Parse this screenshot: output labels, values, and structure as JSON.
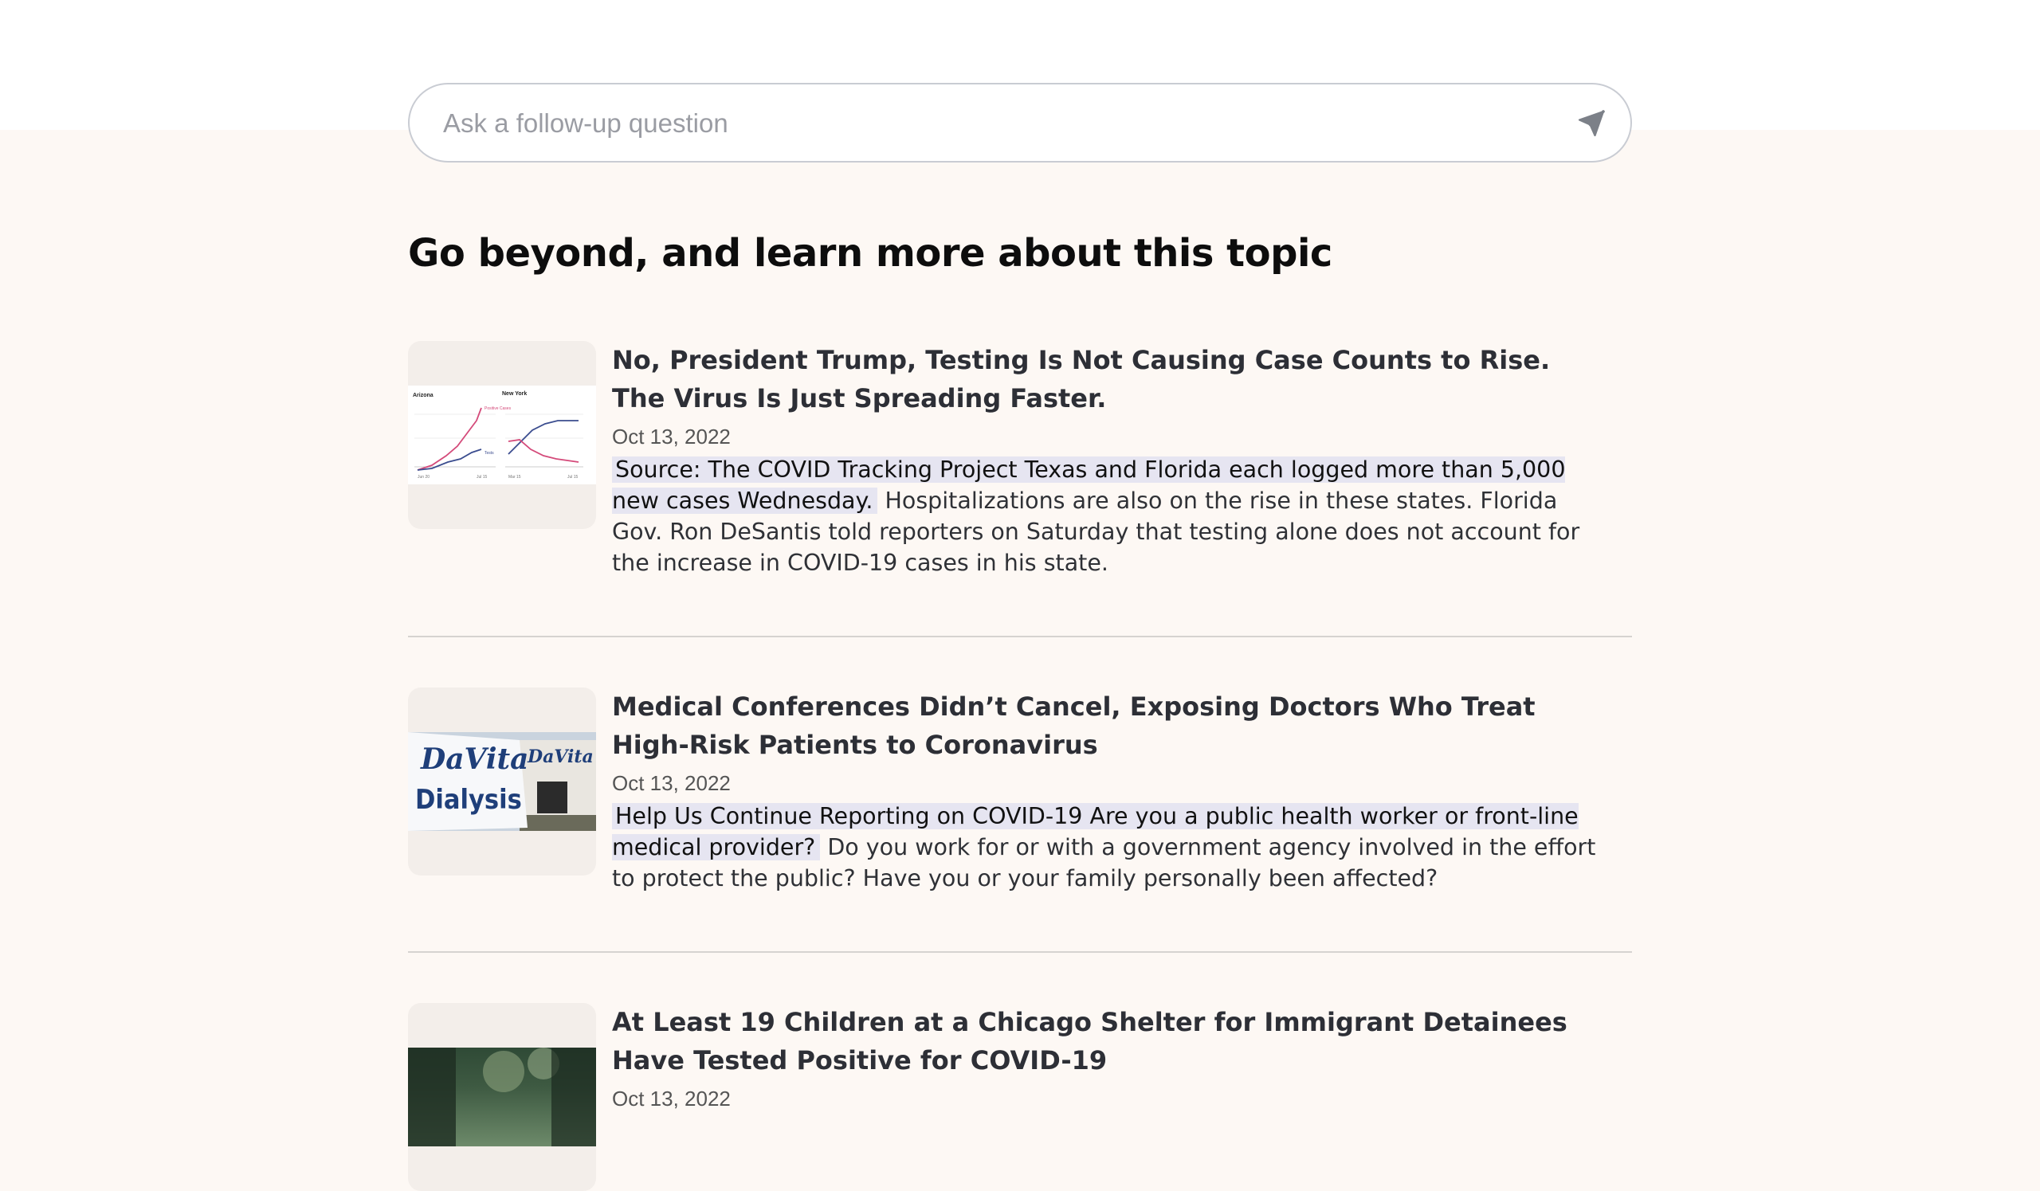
{
  "search": {
    "placeholder": "Ask a follow-up question",
    "send_icon": "send-icon"
  },
  "section": {
    "title": "Go beyond, and learn more about this topic"
  },
  "articles": [
    {
      "title": "No, President Trump, Testing Is Not Causing Case Counts to Rise. The Virus Is Just Spreading Faster.",
      "date": "Oct 13, 2022",
      "highlight": "Source: The COVID Tracking Project Texas and Florida each logged more than 5,000 new cases Wednesday.",
      "snippet": "Hospitalizations are also on the rise in these states. Florida Gov. Ron DeSantis told reporters on Saturday that testing alone does not account for the increase in COVID-19 cases in his state.",
      "thumb": {
        "left_label": "Arizona",
        "right_label": "New York",
        "tag_positive": "Positive Cases",
        "tag_tests": "Tests",
        "x_labels": [
          "Jun 20",
          "Jul 15",
          "Mar 15",
          "Jul 15"
        ]
      }
    },
    {
      "title": "Medical Conferences Didn’t Cancel, Exposing Doctors Who Treat High-Risk Patients to Coronavirus",
      "date": "Oct 13, 2022",
      "highlight": "Help Us Continue Reporting on COVID-19 Are you a public health worker or front-line medical provider?",
      "snippet": "Do you work for or with a government agency involved in the effort to protect the public? Have you or your family personally been affected?",
      "thumb": {
        "sign_line1": "DaVita",
        "sign_line2": "Dialysis",
        "building_sign": "DaVita"
      }
    },
    {
      "title": "At Least 19 Children at a Chicago Shelter for Immigrant Detainees Have Tested Positive for COVID-19",
      "date": "Oct 13, 2022"
    }
  ],
  "colors": {
    "page_bg": "#fdf8f4",
    "highlight_bg": "#e6e5f1",
    "chart_pink": "#d44a7a",
    "chart_blue": "#3b4d8f",
    "davita_blue": "#1f3f7a"
  }
}
